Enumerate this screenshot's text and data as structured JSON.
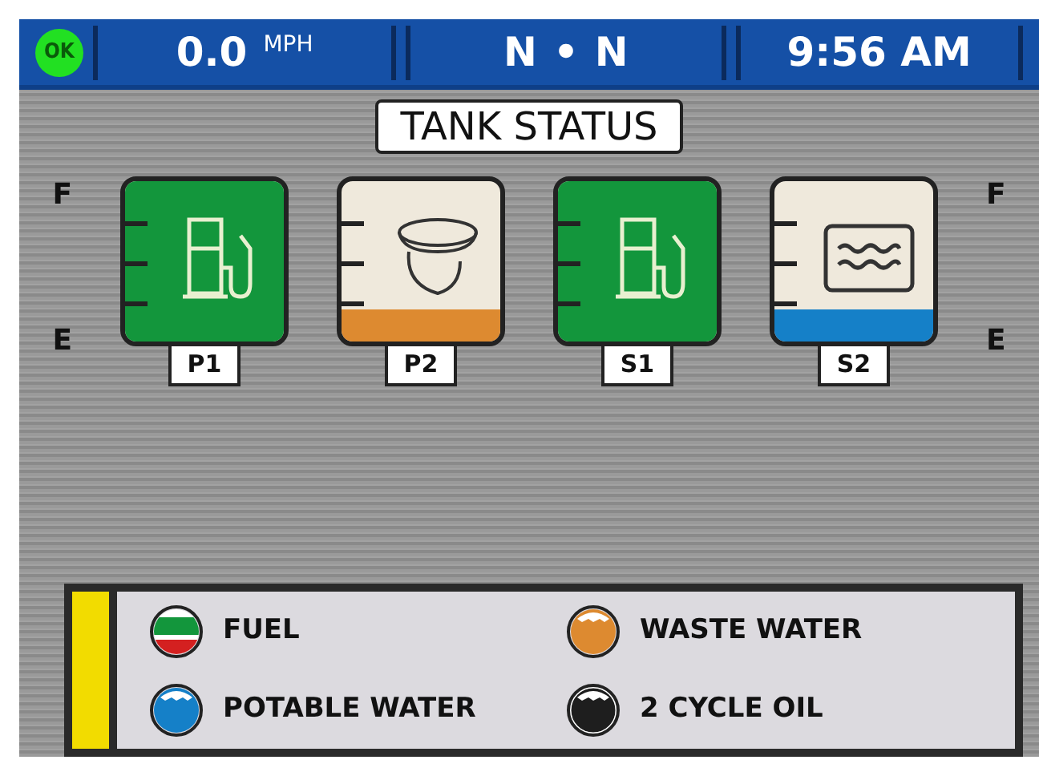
{
  "status_bar": {
    "status": "OK",
    "speed": "0.0",
    "speed_unit": "MPH",
    "heading": [
      "N",
      "•",
      "N"
    ],
    "time": "9:56 AM"
  },
  "title": "TANK STATUS",
  "scale_left": {
    "full": "F",
    "empty": "E"
  },
  "scale_right": {
    "full": "F",
    "empty": "E"
  },
  "tanks": [
    {
      "label": "P1",
      "kind": "fuel",
      "level": 1.0
    },
    {
      "label": "P2",
      "kind": "waste",
      "level": 0.2
    },
    {
      "label": "S1",
      "kind": "fuel",
      "level": 1.0
    },
    {
      "label": "S2",
      "kind": "water",
      "level": 0.2
    }
  ],
  "legend": [
    {
      "label": "FUEL",
      "kind": "fuel"
    },
    {
      "label": "WASTE WATER",
      "kind": "waste"
    },
    {
      "label": "POTABLE WATER",
      "kind": "water"
    },
    {
      "label": "2 CYCLE OIL",
      "kind": "oil"
    }
  ]
}
